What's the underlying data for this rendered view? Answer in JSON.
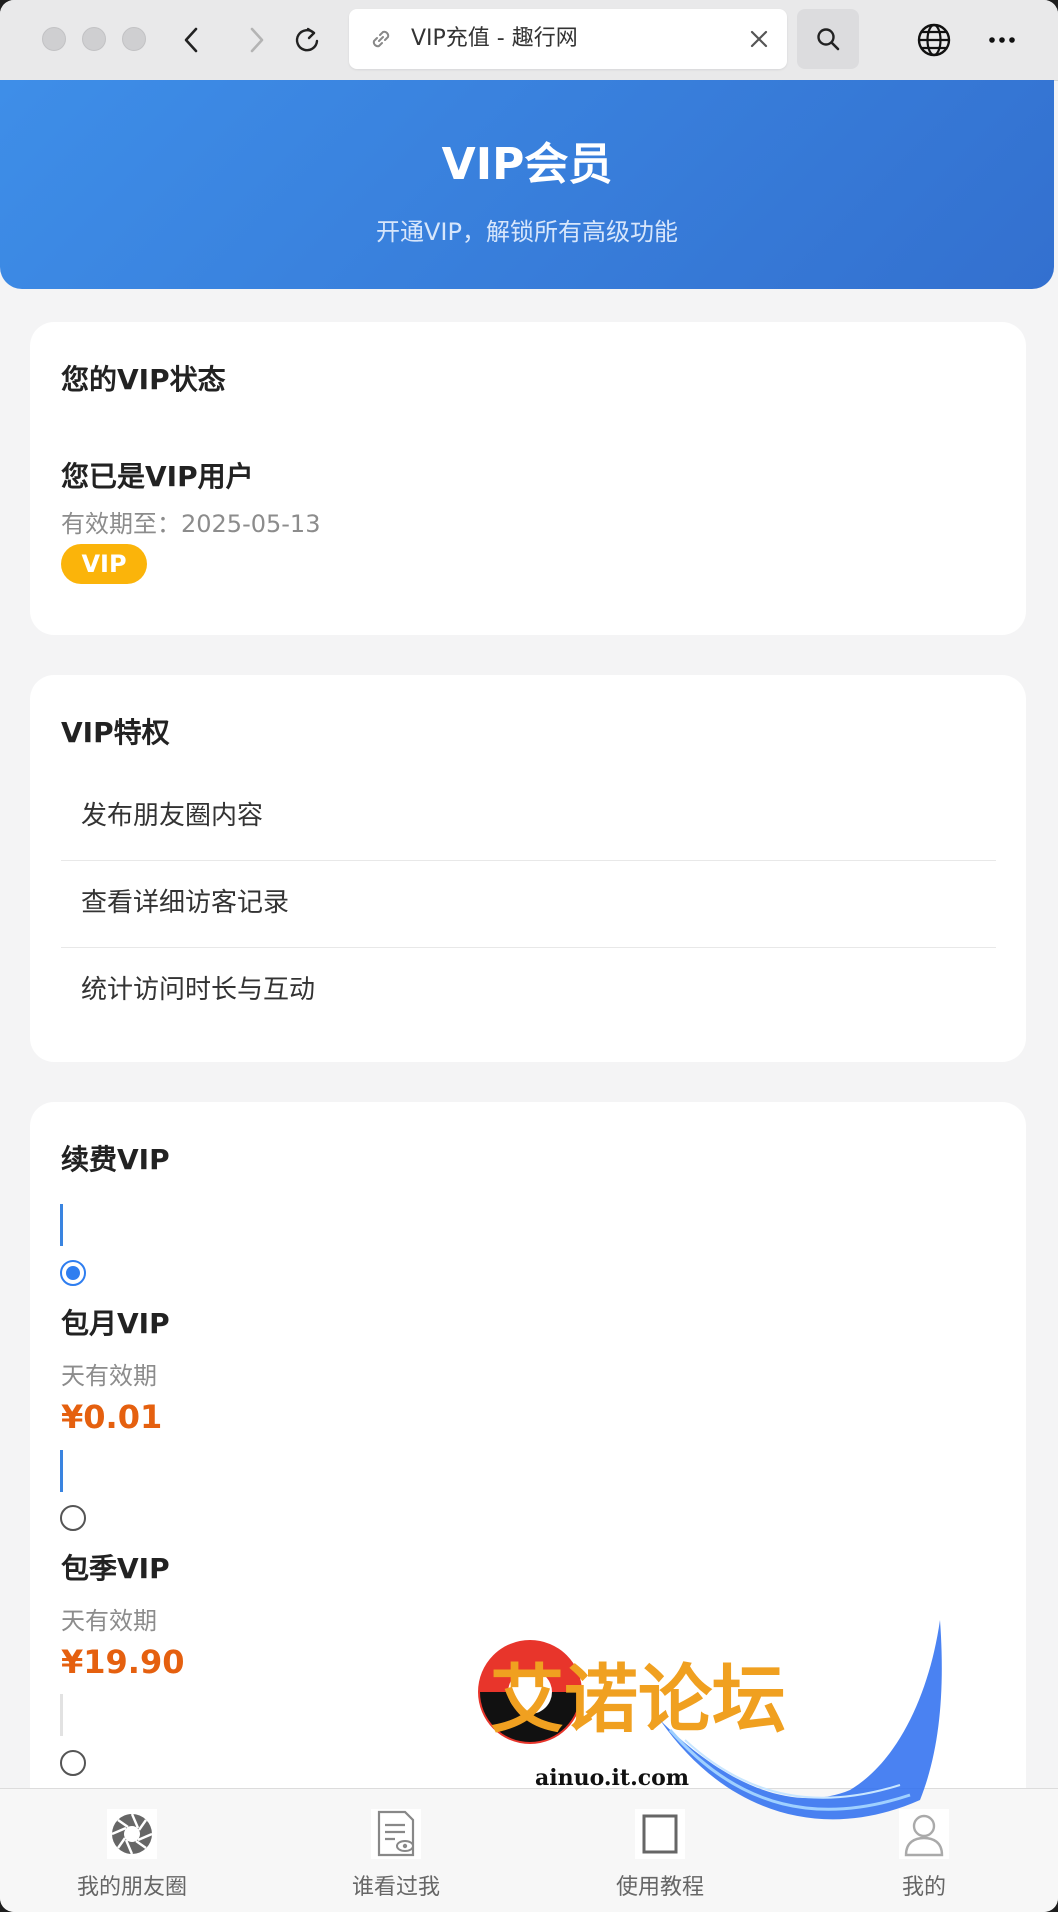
{
  "browser": {
    "tab_title": "VIP充值 - 趣行网"
  },
  "header": {
    "title": "VIP会员",
    "subtitle": "开通VIP，解锁所有高级功能"
  },
  "status_card": {
    "title": "您的VIP状态",
    "heading": "您已是VIP用户",
    "expiry": "有效期至：2025-05-13",
    "badge": "VIP"
  },
  "privileges_card": {
    "title": "VIP特权",
    "items": [
      "发布朋友圈内容",
      "查看详细访客记录",
      "统计访问时长与互动"
    ]
  },
  "renew_card": {
    "title": "续费VIP",
    "plans": [
      {
        "name": "包月VIP",
        "desc": "天有效期",
        "price": "¥0.01",
        "selected": true
      },
      {
        "name": "包季VIP",
        "desc": "天有效期",
        "price": "¥19.90",
        "selected": false
      },
      {
        "name": "",
        "desc": "",
        "price": "",
        "selected": false
      }
    ]
  },
  "bottom_nav": {
    "items": [
      {
        "label": "我的朋友圈",
        "icon": "camera-shutter-icon"
      },
      {
        "label": "谁看过我",
        "icon": "document-eye-icon"
      },
      {
        "label": "使用教程",
        "icon": "tutorial-icon"
      },
      {
        "label": "我的",
        "icon": "user-icon"
      }
    ]
  },
  "watermark": {
    "text": "艾诺论坛",
    "url": "ainuo.it.com"
  },
  "colors": {
    "header_gradient_start": "#3e8ee8",
    "header_gradient_end": "#3370cf",
    "badge": "#fbb40a",
    "price": "#e5600f",
    "radio_selected": "#2f7ef0"
  }
}
